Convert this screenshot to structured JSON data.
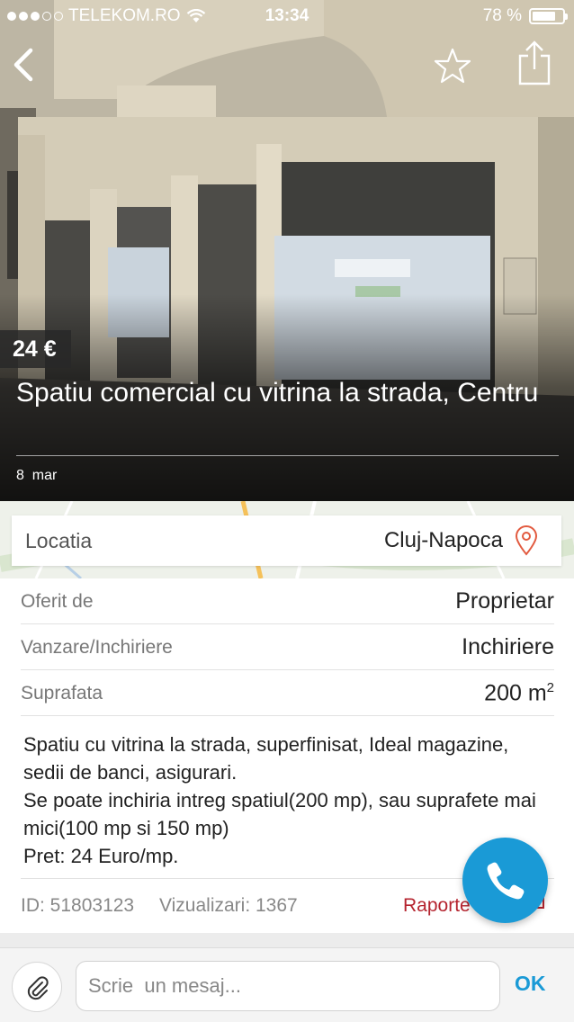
{
  "status_bar": {
    "carrier": "TELEKOM.RO",
    "time": "13:34",
    "battery": "78 %",
    "battery_level": 0.78
  },
  "nav": {
    "back_icon": "chevron-left-icon",
    "favorite_icon": "star-outline-icon",
    "share_icon": "share-icon"
  },
  "listing": {
    "price": "24 €",
    "title": "Spatiu comercial cu vitrina la strada, Centru",
    "date_day": "8",
    "date_month": "mar"
  },
  "location": {
    "label": "Locatia",
    "value": "Cluj-Napoca",
    "icon": "map-pin-icon"
  },
  "details": [
    {
      "key": "Oferit de",
      "value": "Proprietar"
    },
    {
      "key": "Vanzare/Inchiriere",
      "value": "Inchiriere"
    },
    {
      "key": "Suprafata",
      "value": "200 m",
      "unit_sup": "2"
    }
  ],
  "description": "Spatiu cu vitrina la strada, superfinisat, Ideal magazine, sedii de banci, asigurari.\nSe poate inchiria intreg spatiul(200 mp), sau suprafete mai mici(100 mp si 150 mp)\nPret: 24 Euro/mp.",
  "meta": {
    "id": "ID: 51803123",
    "views": "Vizualizari: 1367",
    "report": "Raporte"
  },
  "colors": {
    "accent": "#1a9ad6",
    "report": "#b5242f"
  },
  "message_bar": {
    "placeholder": "Scrie  un mesaj...",
    "send_label": "OK",
    "attach_icon": "paperclip-icon",
    "call_icon": "phone-icon"
  }
}
